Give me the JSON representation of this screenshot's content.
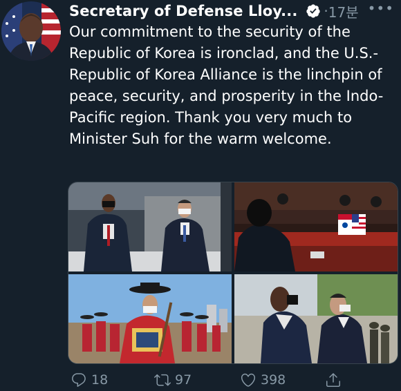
{
  "tweet": {
    "display_name": "Secretary of Defense Lloy...",
    "separator": "·",
    "time": "17분",
    "more": "•••",
    "text": "Our commitment to the security of the Republic of Korea is ironclad, and the U.S.-Republic of Korea Alliance is the linchpin of peace, security, and prosperity in the Indo-Pacific region. Thank you very much to Minister Suh for the warm welcome."
  },
  "actions": {
    "replies": "18",
    "retweets": "97",
    "likes": "398"
  },
  "colors": {
    "background": "#15202b",
    "secondary_text": "#8899a6",
    "verified": "#ffffff"
  },
  "icons": [
    "verified-badge-icon",
    "more-icon",
    "reply-icon",
    "retweet-icon",
    "like-icon",
    "share-icon"
  ]
}
